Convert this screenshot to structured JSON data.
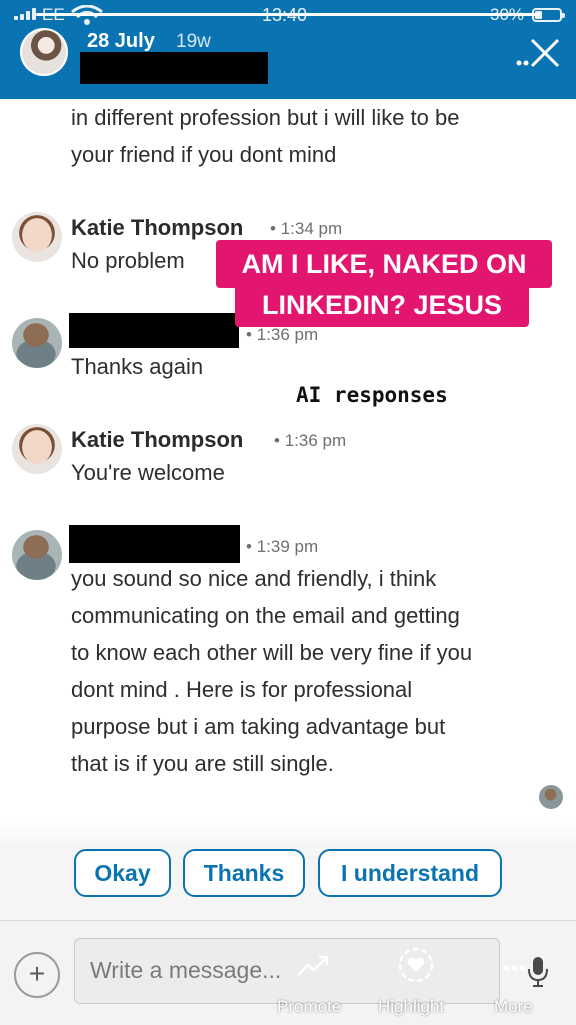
{
  "status_bar": {
    "carrier": "EE",
    "time": "13:40",
    "battery": "30%",
    "battery_level": 0.3,
    "story_progress": 1.0
  },
  "header": {
    "date": "28 July",
    "age": "19w"
  },
  "messages": [
    {
      "text_lines": [
        "in different profession but i will like to be",
        "your friend if you dont mind"
      ]
    },
    {
      "sender": "Katie Thompson",
      "time": "1:34 pm",
      "text": "No problem"
    },
    {
      "time": "1:36 pm",
      "text": "Thanks again"
    },
    {
      "sender": "Katie Thompson",
      "time": "1:36 pm",
      "text": "You're welcome"
    },
    {
      "time": "1:39 pm",
      "text_lines": [
        "you sound so nice and friendly, i think",
        "communicating on the email and getting",
        "to know each other will be very fine if you",
        "dont mind . Here is for professional",
        "purpose but i am taking advantage but",
        "that is if you are still single."
      ]
    }
  ],
  "sticker": {
    "line1": "AM I LIKE, NAKED ON",
    "line2": "LINKEDIN? JESUS"
  },
  "ai_caption": "AI responses",
  "quick_replies": [
    "Okay",
    "Thanks",
    "I understand"
  ],
  "composer": {
    "placeholder": "Write a message..."
  },
  "story_actions": {
    "promote": "Promote",
    "highlight": "Highlight",
    "more": "More"
  },
  "colors": {
    "linkedin_blue": "#0a73b1",
    "sticker_pink": "#e3166f"
  }
}
